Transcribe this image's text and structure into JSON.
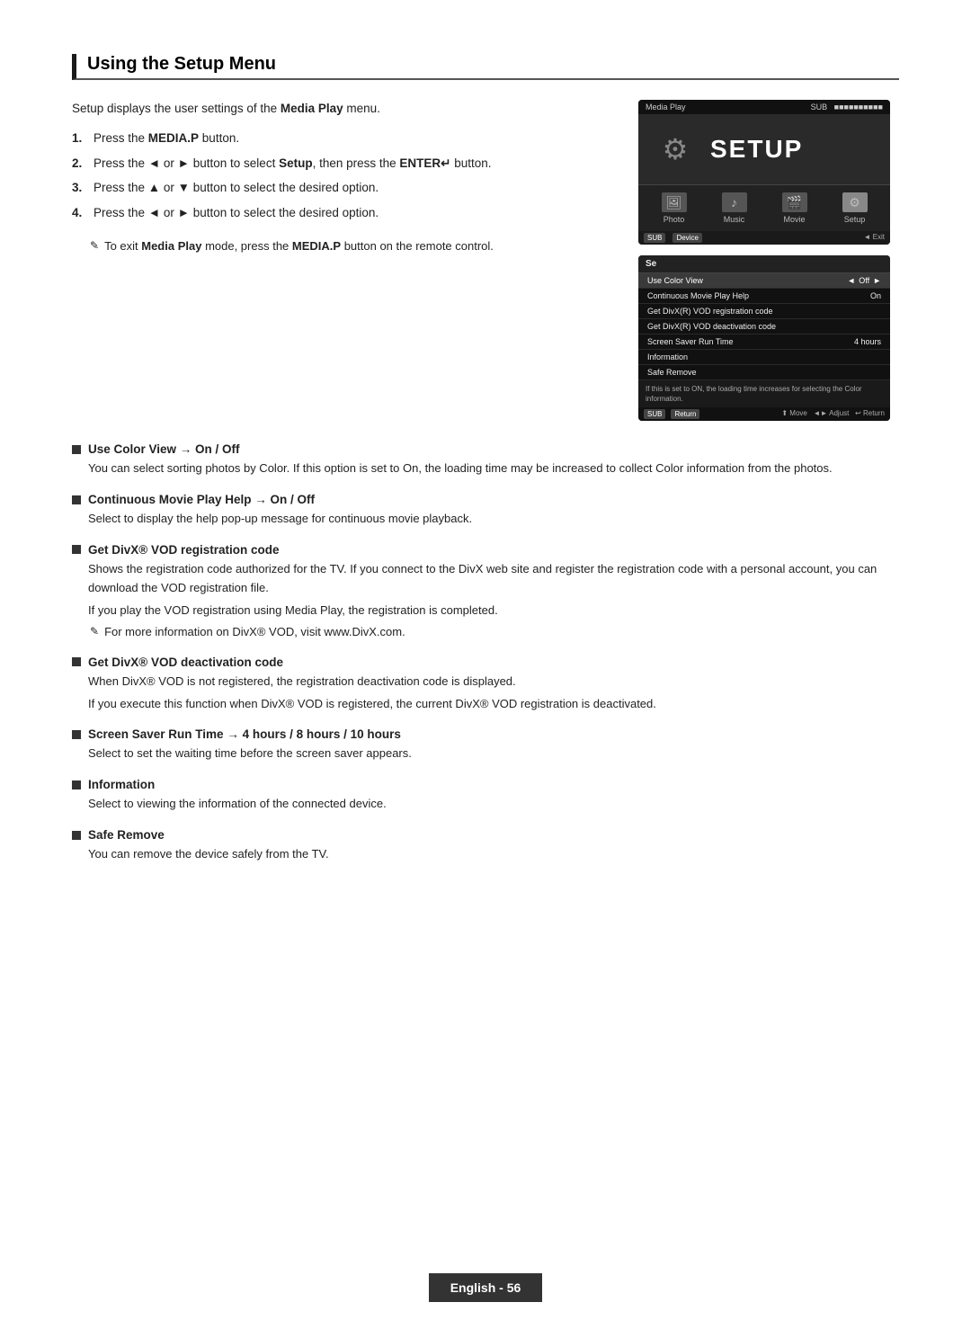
{
  "page": {
    "title": "Using the Setup Menu",
    "footer": "English - 56"
  },
  "intro": {
    "text": "Setup displays the user settings of the Media Play menu."
  },
  "steps": [
    {
      "num": "1.",
      "text": "Press the MEDIA.P button."
    },
    {
      "num": "2.",
      "text": "Press the ◄ or ► button to select Setup, then press the ENTER↵ button."
    },
    {
      "num": "3.",
      "text": "Press the ▲ or ▼ button to select the desired option."
    },
    {
      "num": "4.",
      "text": "Press the ◄ or ► button to select the desired option."
    }
  ],
  "note": "To exit Media Play mode, press the MEDIA.P button on the remote control.",
  "subsections": [
    {
      "id": "use-color-view",
      "title": "Use Color View → On / Off",
      "text": "You can select sorting photos by Color. If this option is set to On, the loading time may be increased to collect Color information from the photos."
    },
    {
      "id": "continuous-movie",
      "title": "Continuous Movie Play Help → On / Off",
      "text": "Select to display the help pop-up message for continuous movie playback."
    },
    {
      "id": "divx-registration",
      "title": "Get DivX® VOD registration code",
      "text1": "Shows the registration code authorized for the TV. If you connect to the DivX web site and register the registration code with a personal account, you can download the VOD registration file.",
      "text2": "If you play the VOD registration using Media Play, the registration is completed.",
      "note": "For more information on DivX® VOD, visit www.DivX.com."
    },
    {
      "id": "divx-deactivation",
      "title": "Get DivX® VOD deactivation code",
      "text1": "When DivX® VOD is not registered, the registration deactivation code is displayed.",
      "text2": "If you execute this function when DivX® VOD is registered, the current DivX® VOD registration is deactivated."
    },
    {
      "id": "screen-saver",
      "title": "Screen Saver Run Time → 4 hours / 8 hours / 10 hours",
      "text": "Select to set the waiting time before the screen saver appears."
    },
    {
      "id": "information",
      "title": "Information",
      "text": "Select to viewing the information of the connected device."
    },
    {
      "id": "safe-remove",
      "title": "Safe Remove",
      "text": "You can remove the device safely from the TV."
    }
  ],
  "tv_screen1": {
    "title": "Media Play",
    "subtitle": "SUB",
    "setup_label": "SETUP",
    "nav_items": [
      "Photo",
      "Music",
      "Movie",
      "Setup"
    ],
    "bottom_btns": [
      "SUB",
      "Device",
      "Exit"
    ]
  },
  "tv_screen2": {
    "title": "Se",
    "menu_items": [
      {
        "label": "Use Color View",
        "value": "Off",
        "has_arrows": true
      },
      {
        "label": "Continuous Movie Play Help",
        "value": "On"
      },
      {
        "label": "Get DivX(R) VOD registration code",
        "value": ""
      },
      {
        "label": "Get DivX(R) VOD deactivation code",
        "value": ""
      },
      {
        "label": "Screen Saver Run Time",
        "value": "4 hours"
      },
      {
        "label": "Information",
        "value": ""
      },
      {
        "label": "Safe Remove",
        "value": ""
      }
    ],
    "note": "If this is set to ON, the loading time increases for selecting the Color information.",
    "bottom_btns": [
      "SUB",
      "Return",
      "Move",
      "Adjust",
      "Return"
    ]
  }
}
